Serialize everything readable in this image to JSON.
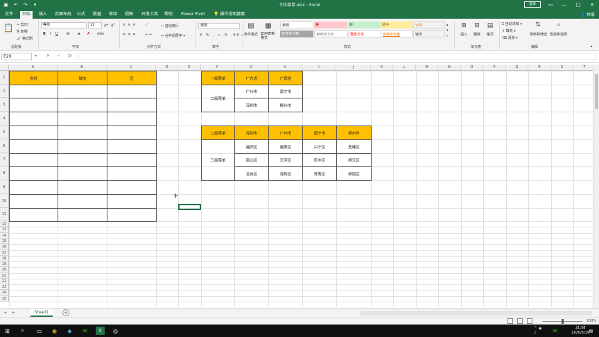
{
  "window": {
    "title": "下拉菜单.xlsx - Excel",
    "login_label": "登录",
    "share_label": "共享"
  },
  "tabs": [
    "文件",
    "开始",
    "插入",
    "页面布局",
    "公式",
    "数据",
    "审阅",
    "视图",
    "开发工具",
    "帮助",
    "Power Pivot",
    "操作说明搜索"
  ],
  "active_tab": "开始",
  "ribbon": {
    "clipboard": {
      "cut": "剪切",
      "copy": "复制",
      "format_painter": "格式刷",
      "label": "剪贴板"
    },
    "font": {
      "name": "等线",
      "size": "11",
      "label": "字体"
    },
    "alignment": {
      "wrap": "自动换行",
      "merge": "合并后居中",
      "label": "对齐方式"
    },
    "number": {
      "format": "常规",
      "label": "数字"
    },
    "styles": {
      "conditional": "条件格式",
      "table_format": "套用表格格式",
      "cells": [
        {
          "text": "常规",
          "bg": "#ffffff",
          "color": "#222222"
        },
        {
          "text": "差",
          "bg": "#ffc7ce",
          "color": "#9c0006"
        },
        {
          "text": "好",
          "bg": "#c6efce",
          "color": "#006100"
        },
        {
          "text": "适中",
          "bg": "#ffeb9c",
          "color": "#9c5700"
        },
        {
          "text": "计算",
          "bg": "#f2f2f2",
          "color": "#fa7d00"
        },
        {
          "text": "检查单元格",
          "bg": "#a5a5a5",
          "color": "#ffffff"
        },
        {
          "text": "解释性文本",
          "bg": "#ffffff",
          "color": "#7f7f7f"
        },
        {
          "text": "警告文本",
          "bg": "#ffffff",
          "color": "#ff0000"
        },
        {
          "text": "链接单元格",
          "bg": "#ffffff",
          "color": "#fa7d00"
        },
        {
          "text": "输出",
          "bg": "#f2f2f2",
          "color": "#3f3f3f"
        }
      ],
      "label": "样式"
    },
    "cells": {
      "insert": "插入",
      "delete": "删除",
      "format": "格式",
      "label": "单元格"
    },
    "editing": {
      "autosum": "自动求和",
      "fill": "填充",
      "clear": "清除",
      "sort": "排序和筛选",
      "find": "查找和选择",
      "label": "编辑"
    }
  },
  "formula_bar": {
    "name_box": "E20",
    "fx": "fx"
  },
  "columns": [
    "A",
    "B",
    "C",
    "D",
    "E",
    "F",
    "G",
    "H",
    "I",
    "J",
    "K",
    "L",
    "M",
    "N",
    "O",
    "P",
    "Q",
    "R",
    "S",
    "T"
  ],
  "rows": [
    "1",
    "2",
    "3",
    "4",
    "5",
    "6",
    "7",
    "8",
    "9",
    "10",
    "11",
    "12",
    "13",
    "14",
    "15",
    "16",
    "17",
    "18",
    "19",
    "20",
    "21",
    "22",
    "23",
    "24",
    "25"
  ],
  "left_table": {
    "headers": [
      "省份",
      "城市",
      "区"
    ]
  },
  "level1": {
    "label": "一级菜单",
    "cols": [
      "广东省",
      "广西省"
    ],
    "level2_label": "二级菜单",
    "rows": [
      [
        "广州市",
        "南宁市"
      ],
      [
        "深圳市",
        "柳州市"
      ]
    ]
  },
  "level2": {
    "label": "二级菜单",
    "cols": [
      "深圳市",
      "广州市",
      "南宁市",
      "柳州市"
    ],
    "level3_label": "三级菜单",
    "rows": [
      [
        "福田区",
        "越秀区",
        "兴宁区",
        "鱼峰区"
      ],
      [
        "南山区",
        "天河区",
        "庆丰区",
        "柳江区"
      ],
      [
        "龙岗区",
        "海珠区",
        "青秀区",
        "柳南区"
      ]
    ]
  },
  "sheet": {
    "name": "Sheet1"
  },
  "status": {
    "zoom": "100%"
  },
  "clock": {
    "time": "21:58",
    "date": "2020/5/19"
  }
}
